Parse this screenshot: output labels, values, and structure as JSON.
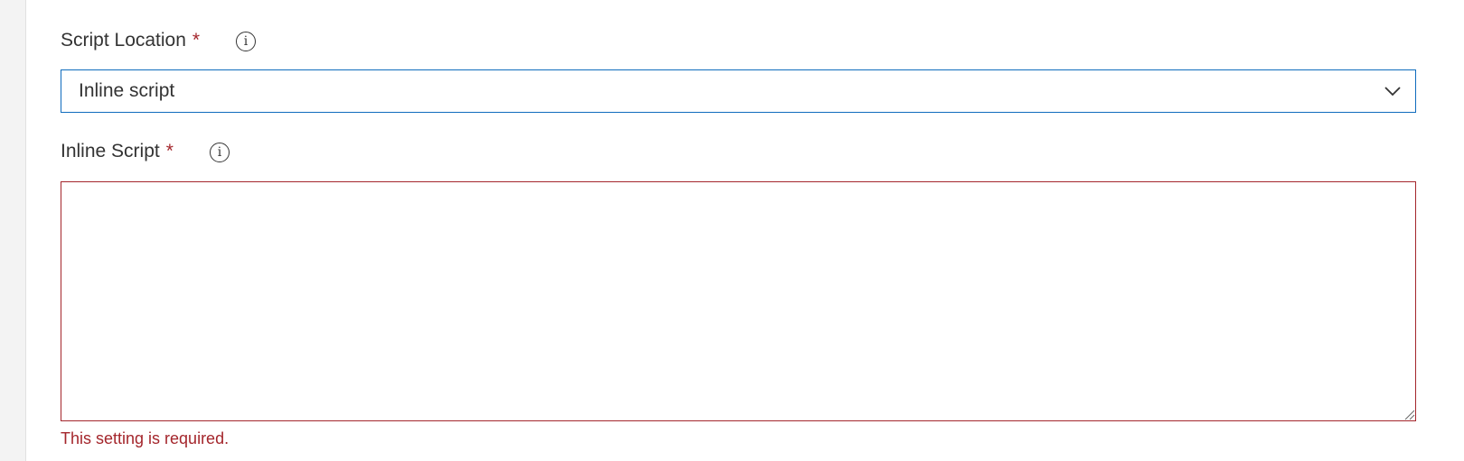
{
  "form": {
    "script_location": {
      "label": "Script Location",
      "required_marker": "*",
      "info_icon": "info-icon",
      "selected_value": "Inline script",
      "dropdown_icon": "chevron-down-icon"
    },
    "inline_script": {
      "label": "Inline Script",
      "required_marker": "*",
      "info_icon": "info-icon",
      "value": "",
      "error_message": "This setting is required."
    }
  },
  "colors": {
    "focus_border": "#0f6cbd",
    "error": "#a4262c",
    "text": "#333333",
    "gutter": "#f3f3f3"
  }
}
